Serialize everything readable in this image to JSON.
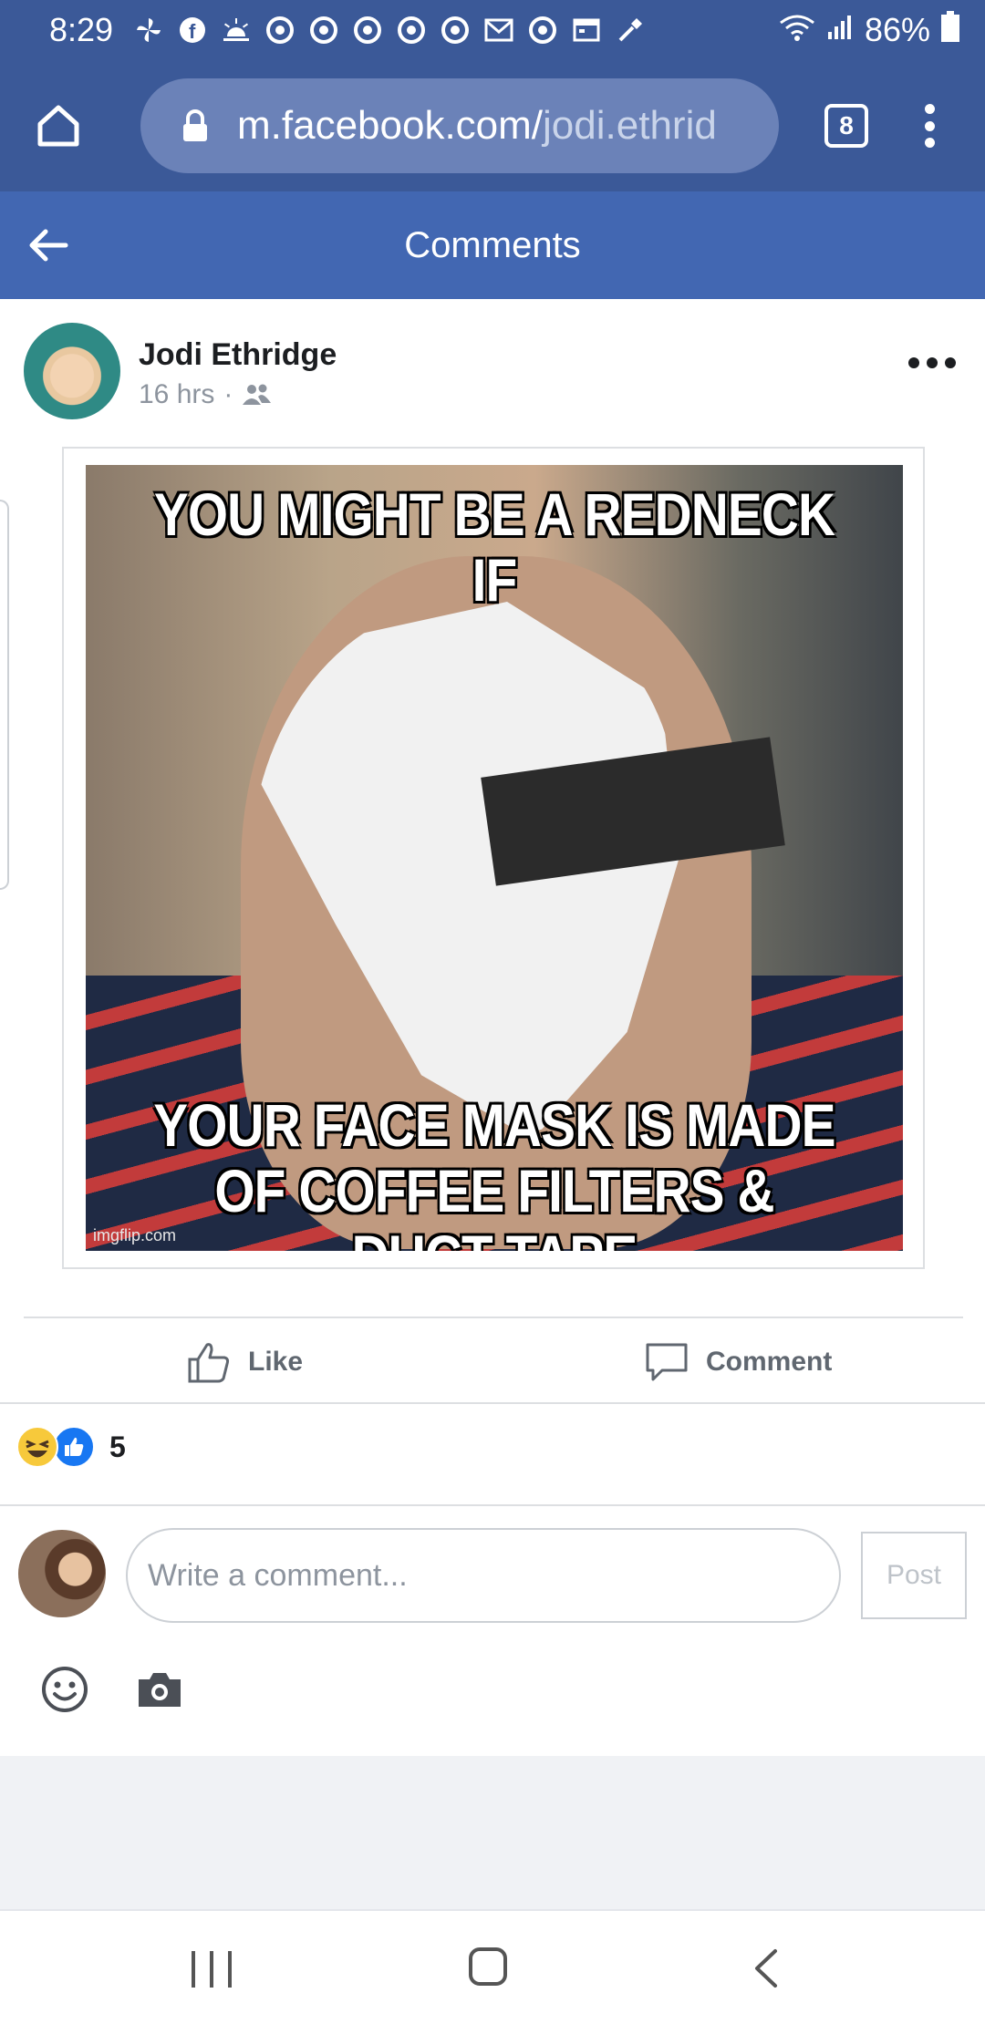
{
  "status_bar": {
    "time": "8:29",
    "notification_icons": [
      "pinwheel-icon",
      "facebook-icon",
      "weather-icon",
      "chrome-icon",
      "chrome-icon",
      "chrome-icon",
      "chrome-icon",
      "chrome-icon",
      "gmail-icon",
      "chrome-icon",
      "calendar-icon",
      "dropper-icon"
    ],
    "battery": "86%"
  },
  "browser": {
    "url_domain": "m.facebook.com/",
    "url_path": "jodi.ethrid",
    "tab_count": "8"
  },
  "header": {
    "title": "Comments"
  },
  "post": {
    "author": "Jodi Ethridge",
    "time": "16 hrs",
    "separator": "·",
    "audience_icon": "friends-icon",
    "meme": {
      "top_text": "YOU MIGHT BE A REDNECK IF",
      "bottom_text": "YOUR FACE MASK IS MADE OF COFFEE FILTERS & DUCT TAPE",
      "watermark": "imgflip.com"
    }
  },
  "actions": {
    "like_label": "Like",
    "comment_label": "Comment"
  },
  "reactions": {
    "types": [
      "haha",
      "like"
    ],
    "count": "5"
  },
  "composer": {
    "placeholder": "Write a comment...",
    "post_label": "Post"
  },
  "colors": {
    "browser_blue": "#3b5998",
    "header_blue": "#4267b2",
    "like_blue": "#1877f2",
    "gray_text": "#606770"
  }
}
